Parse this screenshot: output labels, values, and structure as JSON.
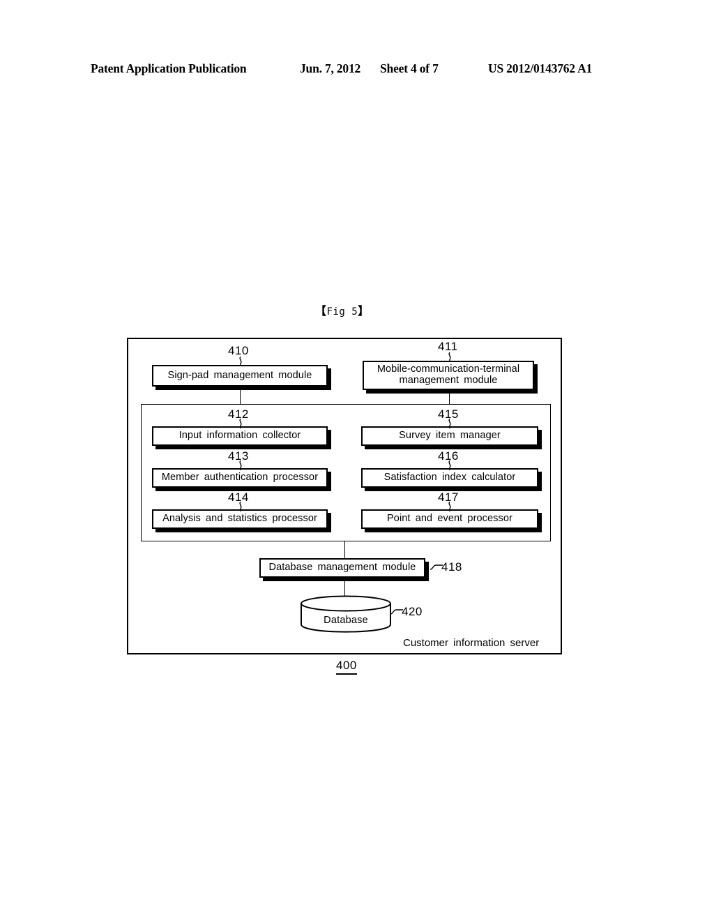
{
  "header": {
    "publication": "Patent Application Publication",
    "date": "Jun. 7, 2012",
    "sheet": "Sheet 4 of 7",
    "patent_number": "US 2012/0143762 A1"
  },
  "figure": {
    "caption_open": "【",
    "caption_text": "Fig 5",
    "caption_close": "】",
    "outer_label": "Customer information server",
    "outer_ref": "400"
  },
  "modules": {
    "m410": {
      "ref": "410",
      "label": "Sign-pad  management  module"
    },
    "m411": {
      "ref": "411",
      "label": "Mobile-communication-terminal management  module"
    },
    "m412": {
      "ref": "412",
      "label": "Input  information  collector"
    },
    "m413": {
      "ref": "413",
      "label": "Member  authentication  processor"
    },
    "m414": {
      "ref": "414",
      "label": "Analysis  and  statistics  processor"
    },
    "m415": {
      "ref": "415",
      "label": "Survey  item  manager"
    },
    "m416": {
      "ref": "416",
      "label": "Satisfaction  index  calculator"
    },
    "m417": {
      "ref": "417",
      "label": "Point  and  event  processor"
    },
    "m418": {
      "ref": "418",
      "label": "Database  management  module"
    }
  },
  "database": {
    "ref": "420",
    "label": "Database"
  }
}
